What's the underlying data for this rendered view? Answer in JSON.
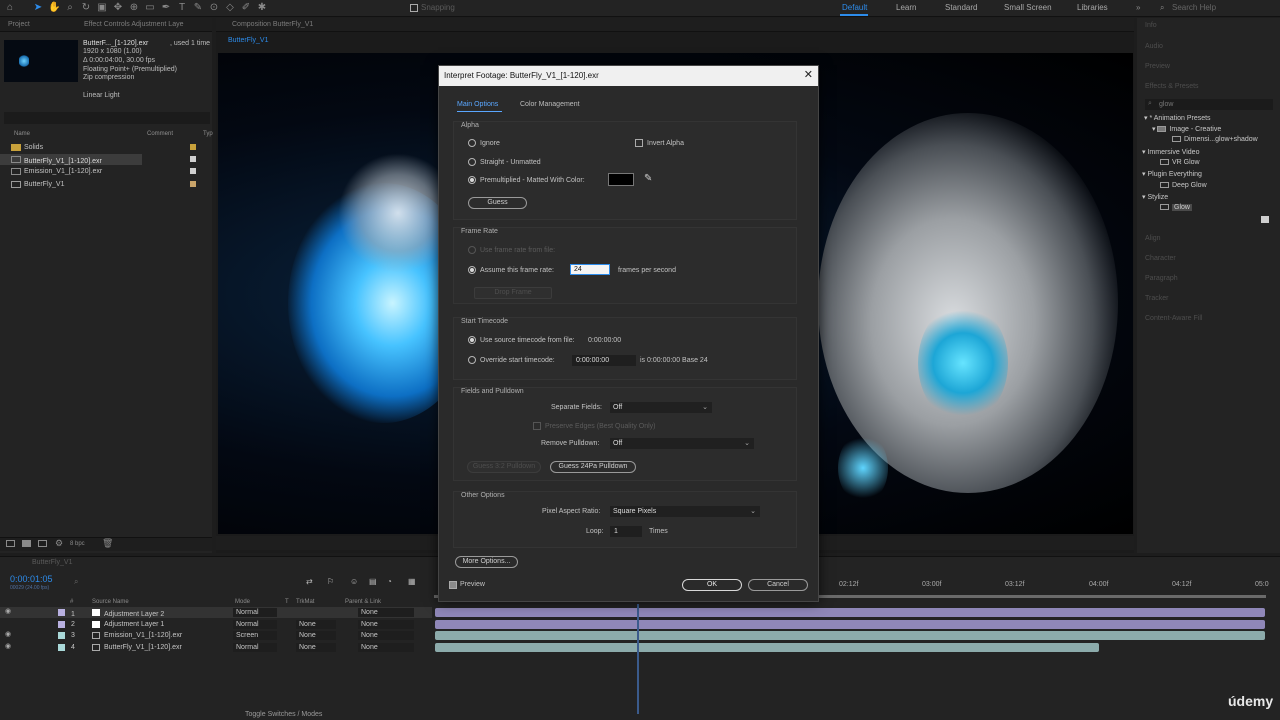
{
  "toolbar": {
    "snapping": "Snapping",
    "workspaces": [
      "Default",
      "Learn",
      "Standard",
      "Small Screen",
      "Libraries"
    ],
    "active_workspace": "Default",
    "search": "Search Help"
  },
  "project": {
    "tabs": [
      "Project",
      "Effect Controls Adjustment Laye"
    ],
    "item_name": "ButterF..._[1-120].exr",
    "used": ", used 1 time",
    "meta": [
      "1920 x 1080 (1.00)",
      "Δ 0:00:04:00, 30.00 fps",
      "Floating Point+ (Premultiplied)",
      "Zip compression"
    ],
    "linear": "Linear Light",
    "columns": [
      "Name",
      "Comment",
      "Typ"
    ],
    "items": [
      {
        "name": "Solids",
        "type": "folder",
        "label": "#c8a13b"
      },
      {
        "name": "ButterFly_V1_[1-120].exr",
        "type": "footage",
        "label": "#d0d0d0",
        "selected": true
      },
      {
        "name": "Emission_V1_[1-120].exr",
        "type": "footage",
        "label": "#d0d0d0"
      },
      {
        "name": "ButterFly_V1",
        "type": "comp",
        "label": "#c9a46a"
      }
    ],
    "bpc": "8 bpc"
  },
  "viewer": {
    "tab": "Composition ButterFly_V1",
    "comp_name": "ButterFly_V1"
  },
  "right_panel": {
    "headers": [
      "Info",
      "Audio",
      "Preview",
      "Effects & Presets"
    ],
    "search": "glow",
    "tree": [
      {
        "label": "* Animation Presets",
        "indent": 0
      },
      {
        "label": "Image - Creative",
        "indent": 1
      },
      {
        "label": "Dimensi...glow+shadow",
        "indent": 2
      },
      {
        "label": "Immersive Video",
        "indent": 0
      },
      {
        "label": "VR Glow",
        "indent": 1
      },
      {
        "label": "Plugin Everything",
        "indent": 0
      },
      {
        "label": "Deep Glow",
        "indent": 1
      },
      {
        "label": "Stylize",
        "indent": 0
      },
      {
        "label": "Glow",
        "indent": 1
      }
    ],
    "lower_headers": [
      "Align",
      "Character",
      "Paragraph",
      "Tracker",
      "Content-Aware Fill"
    ]
  },
  "dialog": {
    "title": "Interpret Footage: ButterFly_V1_[1-120].exr",
    "tabs": [
      "Main Options",
      "Color Management"
    ],
    "alpha": {
      "title": "Alpha",
      "ignore": "Ignore",
      "invert": "Invert Alpha",
      "straight": "Straight - Unmatted",
      "premult": "Premultiplied - Matted With Color:",
      "matte_color": "#000000",
      "guess": "Guess"
    },
    "frame_rate": {
      "title": "Frame Rate",
      "use_file": "Use frame rate from file:",
      "assume": "Assume this frame rate:",
      "value": "24",
      "unit": "frames per second",
      "drop_frame": "Drop Frame"
    },
    "start_timecode": {
      "title": "Start Timecode",
      "use_source": "Use source timecode from file:",
      "source_value": "0:00:00:00",
      "override": "Override start timecode:",
      "override_value": "0:00:00:00",
      "is_label": "is 0:00:00:00  Base 24"
    },
    "fields": {
      "title": "Fields and Pulldown",
      "separate_label": "Separate Fields:",
      "separate_value": "Off",
      "preserve": "Preserve Edges (Best Quality Only)",
      "remove_label": "Remove Pulldown:",
      "remove_value": "Off",
      "guess3": "Guess 3:2 Pulldown",
      "guess24": "Guess 24Pa Pulldown"
    },
    "other": {
      "title": "Other Options",
      "par_label": "Pixel Aspect Ratio:",
      "par_value": "Square Pixels",
      "loop_label": "Loop:",
      "loop_value": "1",
      "times": "Times"
    },
    "more_options": "More Options...",
    "preview": "Preview",
    "ok": "OK",
    "cancel": "Cancel"
  },
  "timeline": {
    "tab": "ButterFly_V1",
    "timecode": "0:00:01:05",
    "timecode_sub": "00029 (24.00 fps)",
    "headers": [
      "#",
      "Source Name",
      "Mode",
      "T",
      "TrkMat",
      "Parent & Link"
    ],
    "layers": [
      {
        "num": "1",
        "name": "Adjustment Layer 2",
        "mode": "Normal",
        "trkmat": "",
        "parent": "None",
        "color": "#b8b0e0",
        "selected": true
      },
      {
        "num": "2",
        "name": "Adjustment Layer 1",
        "mode": "Normal",
        "trkmat": "None",
        "parent": "None",
        "color": "#b8b0e0"
      },
      {
        "num": "3",
        "name": "Emission_V1_[1-120].exr",
        "mode": "Screen",
        "trkmat": "None",
        "parent": "None",
        "color": "#a9d8d8"
      },
      {
        "num": "4",
        "name": "ButterFly_V1_[1-120].exr",
        "mode": "Normal",
        "trkmat": "None",
        "parent": "None",
        "color": "#a9d8d8"
      }
    ],
    "ruler": [
      "02:12f",
      "03:00f",
      "03:12f",
      "04:00f",
      "04:12f",
      "05:0"
    ],
    "toggle": "Toggle Switches / Modes"
  },
  "brand": "údemy",
  "colors": {
    "accent": "#2d8ceb",
    "dialog_bg": "#2a2a2a",
    "panel_bg": "#232323"
  }
}
